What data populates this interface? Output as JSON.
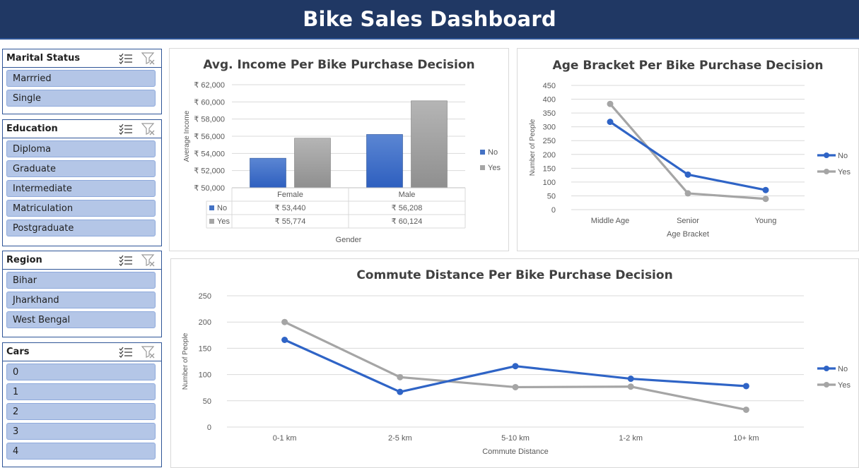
{
  "header": {
    "title": "Bike Sales Dashboard"
  },
  "slicers": [
    {
      "id": "marital",
      "title": "Marital Status",
      "items": [
        "Marrried",
        "Single"
      ]
    },
    {
      "id": "education",
      "title": "Education",
      "items": [
        "Diploma",
        "Graduate",
        "Intermediate",
        "Matriculation",
        "Postgraduate"
      ]
    },
    {
      "id": "region",
      "title": "Region",
      "items": [
        "Bihar",
        "Jharkhand",
        "West Bengal"
      ]
    },
    {
      "id": "cars",
      "title": "Cars",
      "items": [
        "0",
        "1",
        "2",
        "3",
        "4"
      ]
    }
  ],
  "icons": {
    "multiselect": "multi-select-icon",
    "clear_filter": "clear-filter-icon"
  },
  "colors": {
    "no": "#4472c4",
    "yes": "#a5a5a5",
    "header": "#203864",
    "slicer_item": "#b4c6e7"
  },
  "chart_data": [
    {
      "type": "bar",
      "title": "Avg. Income Per Bike Purchase Decision",
      "xlabel": "Gender",
      "ylabel": "Average Income",
      "categories": [
        "Female",
        "Male"
      ],
      "series": [
        {
          "name": "No",
          "values": [
            53440,
            56208
          ],
          "labels": [
            "₹ 53,440",
            "₹ 56,208"
          ]
        },
        {
          "name": "Yes",
          "values": [
            55774,
            60124
          ],
          "labels": [
            "₹ 55,774",
            "₹ 60,124"
          ]
        }
      ],
      "ylim": [
        50000,
        62000
      ],
      "yticks": [
        "₹ 50,000",
        "₹ 52,000",
        "₹ 54,000",
        "₹ 56,000",
        "₹ 58,000",
        "₹ 60,000",
        "₹ 62,000"
      ],
      "legend": "right",
      "data_table": true
    },
    {
      "type": "line",
      "title": "Age Bracket Per Bike Purchase Decision",
      "xlabel": "Age Bracket",
      "ylabel": "Number of People",
      "categories": [
        "Middle Age",
        "Senior",
        "Young"
      ],
      "series": [
        {
          "name": "No",
          "values": [
            318,
            127,
            71
          ]
        },
        {
          "name": "Yes",
          "values": [
            383,
            59,
            39
          ]
        }
      ],
      "ylim": [
        0,
        450
      ],
      "yticks": [
        "0",
        "50",
        "100",
        "150",
        "200",
        "250",
        "300",
        "350",
        "400",
        "450"
      ],
      "legend": "right"
    },
    {
      "type": "line",
      "title": "Commute Distance Per Bike Purchase Decision",
      "xlabel": "Commute Distance",
      "ylabel": "Number of People",
      "categories": [
        "0-1 km",
        "2-5 km",
        "5-10 km",
        "1-2 km",
        "10+ km"
      ],
      "series": [
        {
          "name": "No",
          "values": [
            166,
            67,
            116,
            92,
            78
          ]
        },
        {
          "name": "Yes",
          "values": [
            200,
            95,
            76,
            77,
            33
          ]
        }
      ],
      "ylim": [
        0,
        250
      ],
      "yticks": [
        "0",
        "50",
        "100",
        "150",
        "200",
        "250"
      ],
      "legend": "right"
    }
  ]
}
